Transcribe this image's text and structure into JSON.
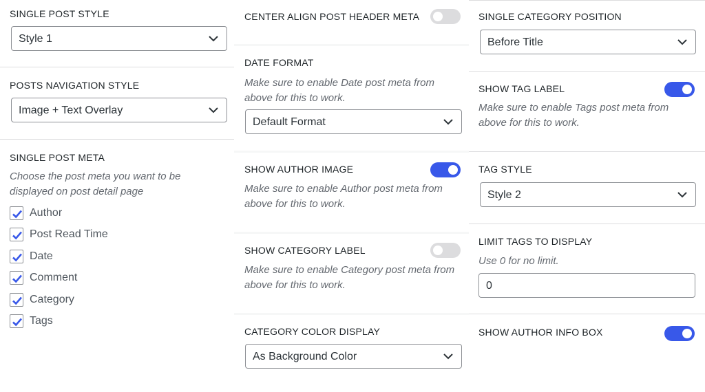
{
  "colors": {
    "accent": "#3858e9",
    "toggle_off": "#dcdcde",
    "divider": "#dcdcde",
    "description": "#646970",
    "check": "#3858e9"
  },
  "left": {
    "single_post_style": {
      "label": "SINGLE POST STYLE",
      "value": "Style 1"
    },
    "posts_navigation_style": {
      "label": "POSTS NAVIGATION STYLE",
      "value": "Image + Text Overlay"
    },
    "single_post_meta": {
      "label": "SINGLE POST META",
      "description": "Choose the post meta you want to be displayed on post detail page",
      "options": [
        {
          "label": "Author",
          "checked": true
        },
        {
          "label": "Post Read Time",
          "checked": true
        },
        {
          "label": "Date",
          "checked": true
        },
        {
          "label": "Comment",
          "checked": true
        },
        {
          "label": "Category",
          "checked": true
        },
        {
          "label": "Tags",
          "checked": true
        }
      ]
    }
  },
  "middle": {
    "center_align_meta": {
      "label": "CENTER ALIGN POST HEADER META",
      "enabled": false
    },
    "date_format": {
      "label": "DATE FORMAT",
      "description": "Make sure to enable Date post meta from above for this to work.",
      "value": "Default Format"
    },
    "show_author_image": {
      "label": "SHOW AUTHOR IMAGE",
      "enabled": true,
      "description": "Make sure to enable Author post meta from above for this to work."
    },
    "show_category_label": {
      "label": "SHOW CATEGORY LABEL",
      "enabled": false,
      "description": "Make sure to enable Category post meta from above for this to work."
    },
    "category_color_display": {
      "label": "CATEGORY COLOR DISPLAY",
      "value": "As Background Color"
    }
  },
  "right": {
    "single_category_position": {
      "label": "SINGLE CATEGORY POSITION",
      "value": "Before Title"
    },
    "show_tag_label": {
      "label": "SHOW TAG LABEL",
      "enabled": true,
      "description": "Make sure to enable Tags post meta from above for this to work."
    },
    "tag_style": {
      "label": "TAG STYLE",
      "value": "Style 2"
    },
    "limit_tags": {
      "label": "LIMIT TAGS TO DISPLAY",
      "description": "Use 0 for no limit.",
      "value": "0"
    },
    "show_author_info_box": {
      "label": "SHOW AUTHOR INFO BOX",
      "enabled": true
    }
  }
}
